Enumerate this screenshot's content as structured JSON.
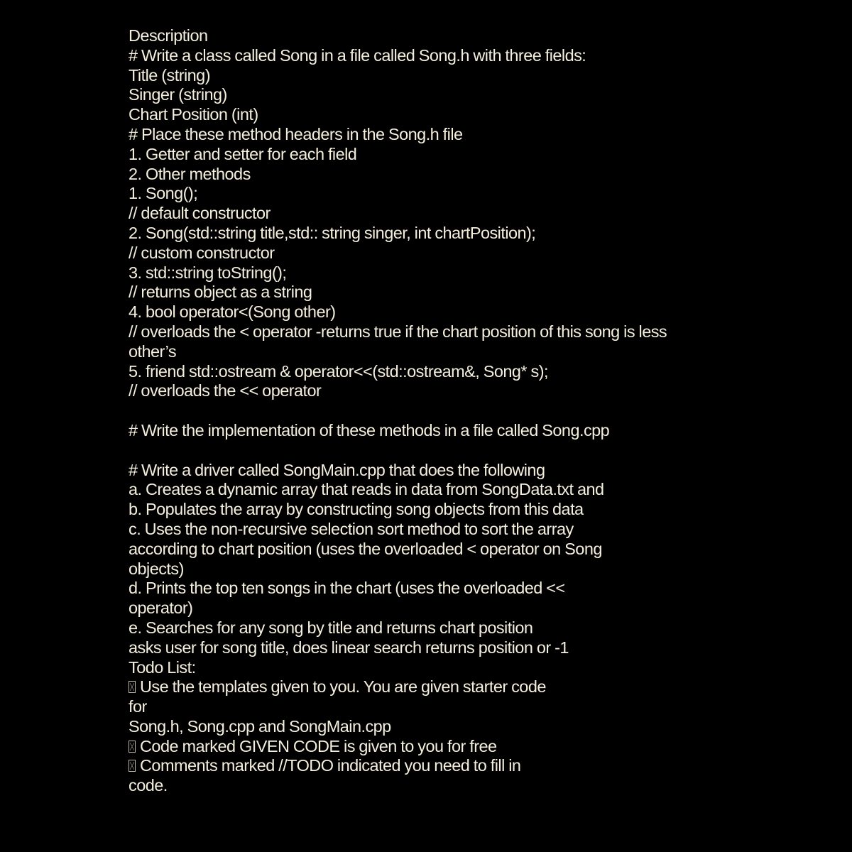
{
  "document": {
    "title": "Description",
    "section_class": {
      "heading": "# Write a class called Song in a file called Song.h with three fields:",
      "fields": [
        "Title (string)",
        "Singer (string)",
        "Chart Position (int)"
      ]
    },
    "section_headers": {
      "heading": "# Place these method headers in the Song.h file",
      "items": [
        "1. Getter and setter for each field",
        "2. Other methods",
        "1. Song();",
        "// default constructor",
        "2. Song(std::string title,std:: string singer, int chartPosition);",
        "// custom constructor",
        "3. std::string toString();",
        "// returns object as a string",
        "4. bool operator<(Song other)",
        "// overloads the < operator -returns true if the chart position of this song is less",
        "other’s",
        "5. friend std::ostream & operator<<(std::ostream&, Song* s);",
        "// overloads the << operator"
      ]
    },
    "section_impl": {
      "heading": "# Write the implementation of these methods in a file called Song.cpp"
    },
    "section_driver": {
      "heading": "# Write a driver called SongMain.cpp that does the following",
      "items": [
        "a. Creates a dynamic array that reads in data from SongData.txt and",
        "b. Populates the array by constructing song objects from this data",
        "c. Uses the non-recursive selection sort method to sort the array",
        "according to chart position (uses the overloaded < operator on Song",
        "objects)",
        "d. Prints the top ten songs in the chart (uses the overloaded <<",
        "operator)",
        "e. Searches for any song by title and returns chart position",
        "asks user for song title, does linear search returns position or -1"
      ]
    },
    "todo": {
      "heading": "Todo List:",
      "bullet_icon": "missing-glyph-box",
      "items": [
        "Use the templates given to you. You are given starter code",
        "for",
        "Song.h, Song.cpp and SongMain.cpp",
        "Code marked GIVEN CODE is given to you for free",
        "Comments marked //TODO indicated you need to fill in",
        "code."
      ]
    }
  },
  "colors": {
    "background": "#000000",
    "text": "#f4eedd"
  }
}
